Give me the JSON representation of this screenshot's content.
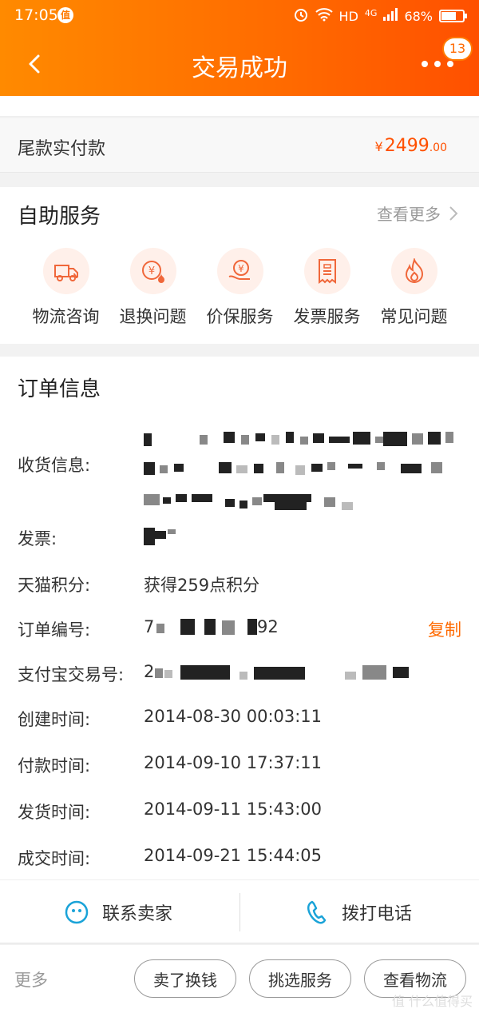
{
  "status_bar": {
    "time": "17:05",
    "badge": "值",
    "network": "HD",
    "signal": "4G",
    "battery": "68%"
  },
  "header": {
    "title": "交易成功",
    "more_badge": "13"
  },
  "final_payment": {
    "label": "尾款实付款",
    "currency": "¥",
    "amount_int": "2499",
    "amount_dec": ".00"
  },
  "self_service": {
    "title": "自助服务",
    "more": "查看更多",
    "items": [
      {
        "label": "物流咨询",
        "icon": "truck-icon"
      },
      {
        "label": "退换问题",
        "icon": "refund-icon"
      },
      {
        "label": "价保服务",
        "icon": "price-protect-icon"
      },
      {
        "label": "发票服务",
        "icon": "invoice-icon"
      },
      {
        "label": "常见问题",
        "icon": "fire-icon"
      }
    ]
  },
  "order_info": {
    "title": "订单信息",
    "shipping_label": "收货信息:",
    "invoice_label": "发票:",
    "points_label": "天猫积分:",
    "points_value": "获得259点积分",
    "order_no_label": "订单编号:",
    "order_no_prefix": "7",
    "order_no_suffix": "92",
    "copy": "复制",
    "alipay_label": "支付宝交易号:",
    "alipay_prefix": "2",
    "created_label": "创建时间:",
    "created_value": "2014-08-30 00:03:11",
    "paid_label": "付款时间:",
    "paid_value": "2014-09-10 17:37:11",
    "shipped_label": "发货时间:",
    "shipped_value": "2014-09-11 15:43:00",
    "deal_label": "成交时间:",
    "deal_value": "2014-09-21 15:44:05"
  },
  "contact": {
    "seller": "联系卖家",
    "call": "拨打电话"
  },
  "bottom_bar": {
    "more": "更多",
    "sell": "卖了换钱",
    "pick_service": "挑选服务",
    "view_logistics": "查看物流"
  },
  "watermark": "值 什么值得买",
  "colors": {
    "accent": "#ff6a00",
    "header_start": "#ff8a00",
    "header_end": "#ff5000",
    "price": "#ff5000"
  }
}
